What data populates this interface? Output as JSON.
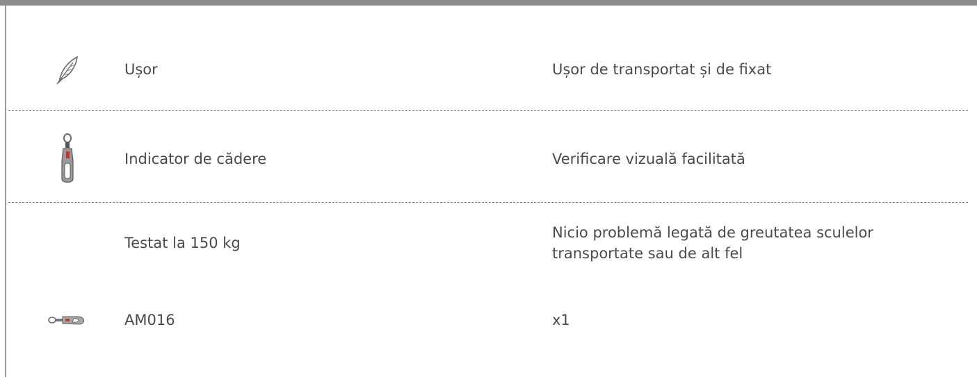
{
  "rows": [
    {
      "icon": "feather-icon",
      "feature": "Ușor",
      "benefit": "Ușor de transportat și de fixat"
    },
    {
      "icon": "fall-indicator-hook-icon",
      "feature": "Indicator de cădere",
      "benefit": "Verificare vizuală facilitată"
    },
    {
      "icon": "",
      "feature": "Testat la 150 kg",
      "benefit": "Nicio problemă legată de greutatea sculelor transportate sau de alt fel"
    },
    {
      "icon": "snap-hook-icon",
      "feature": "AM016",
      "benefit": "x1"
    }
  ],
  "colors": {
    "top_bar": "#8c8c8c",
    "text": "#4a4a4a",
    "divider": "#7a7a7a"
  }
}
